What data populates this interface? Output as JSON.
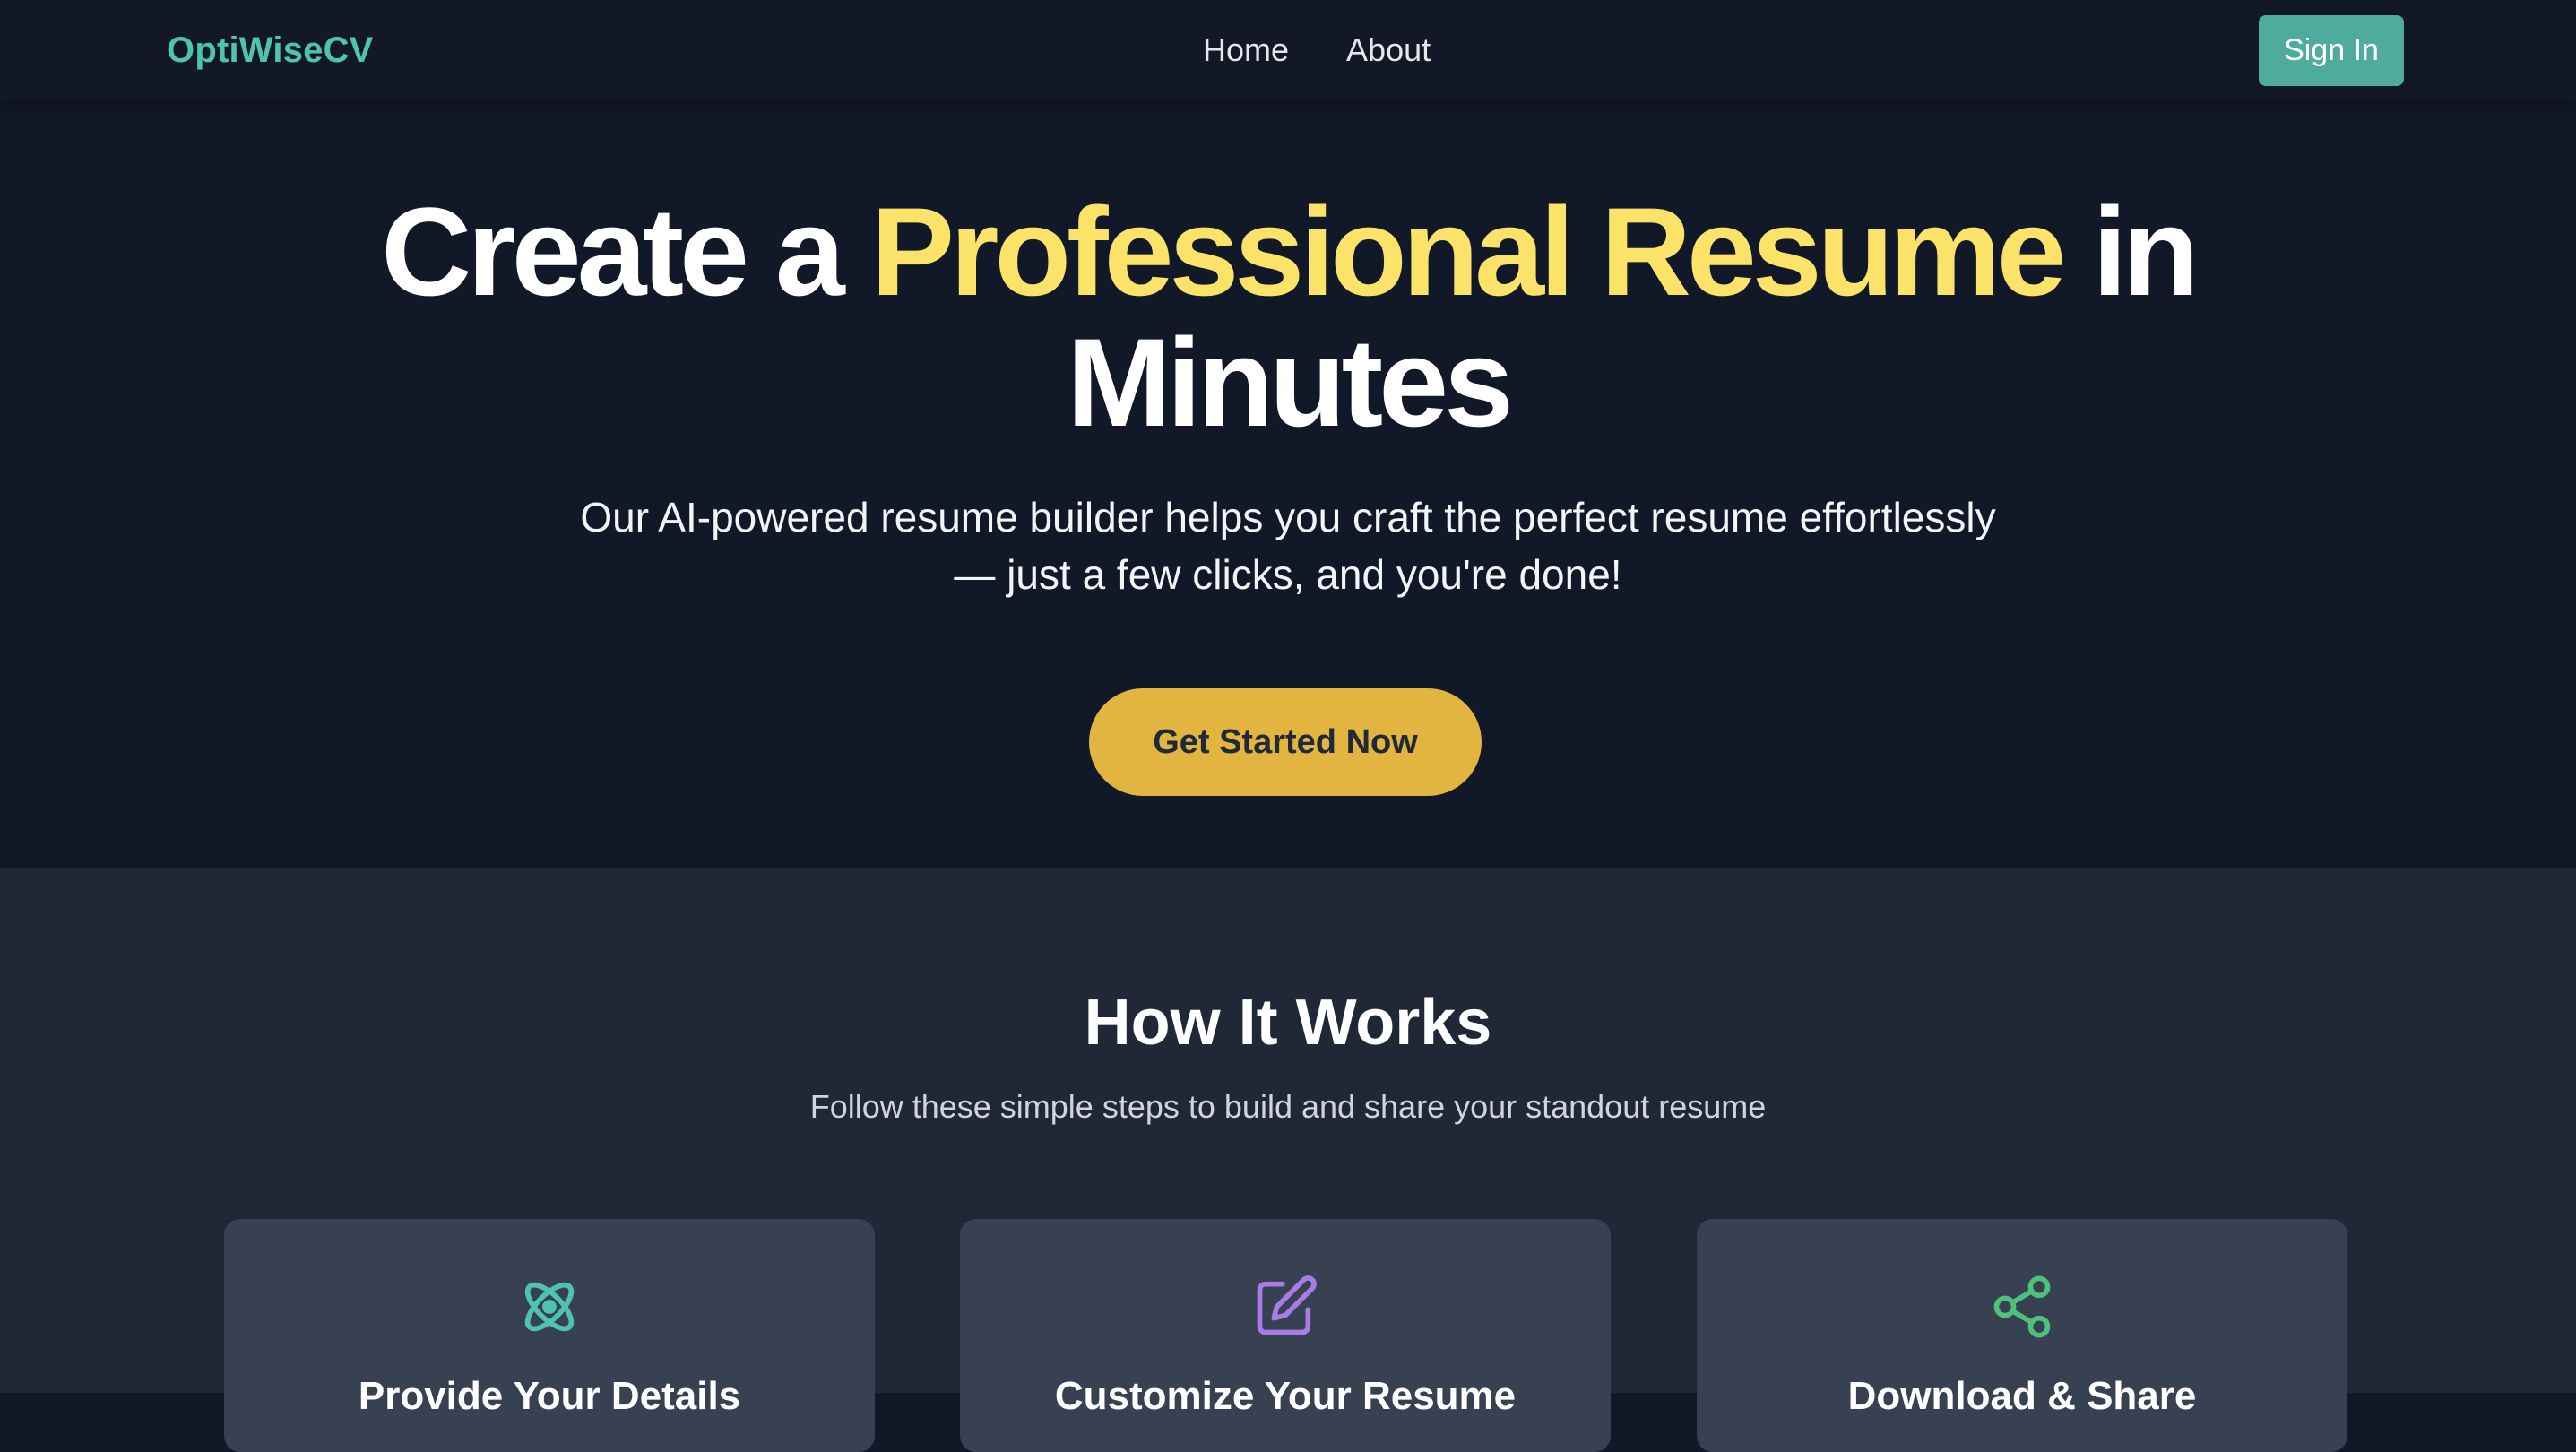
{
  "nav": {
    "brand": "OptiWiseCV",
    "links": [
      {
        "label": "Home"
      },
      {
        "label": "About"
      }
    ],
    "signin_label": "Sign In"
  },
  "hero": {
    "title_prefix": "Create a ",
    "title_highlight": "Professional Resume",
    "title_suffix": " in Minutes",
    "subtitle_line1": "Our AI-powered resume builder helps you craft the perfect resume effortlessly",
    "subtitle_line2": "— just a few clicks, and you're done!",
    "cta_label": "Get Started Now"
  },
  "how": {
    "title": "How It Works",
    "subtitle": "Follow these simple steps to build and share your standout resume",
    "steps": [
      {
        "icon": "atom-icon",
        "title": "Provide Your Details",
        "color": "#4fc3ae"
      },
      {
        "icon": "edit-icon",
        "title": "Customize Your Resume",
        "color": "#a97be6"
      },
      {
        "icon": "share-icon",
        "title": "Download & Share",
        "color": "#4ec27a"
      }
    ]
  },
  "colors": {
    "brand": "#4fc3ae",
    "accent_yellow": "#fbe36a",
    "cta": "#e1b53f",
    "signin": "#4eab9d",
    "hero_bg": "#111827",
    "section_bg": "#202737",
    "card_bg": "#374151"
  }
}
